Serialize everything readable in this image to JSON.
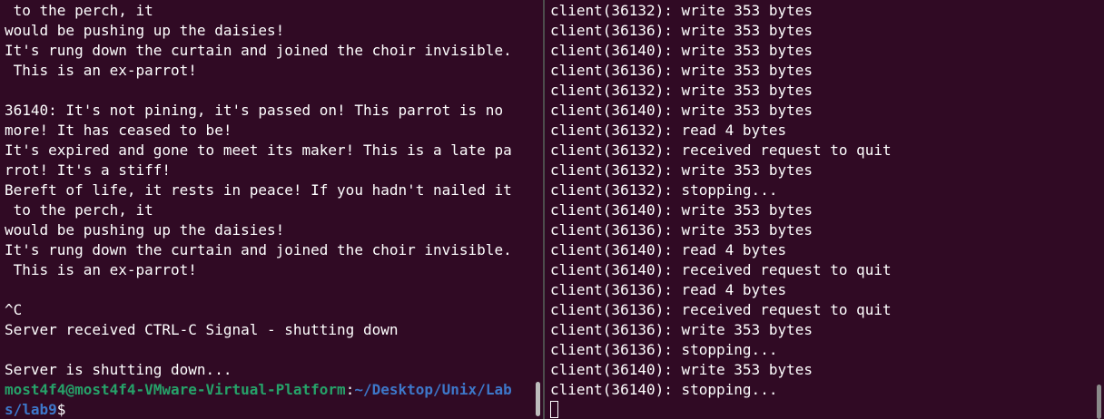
{
  "left_pane": {
    "lines": [
      " to the perch, it",
      "would be pushing up the daisies!",
      "It's rung down the curtain and joined the choir invisible.",
      " This is an ex-parrot!",
      "",
      "36140: It's not pining, it's passed on! This parrot is no",
      "more! It has ceased to be!",
      "It's expired and gone to meet its maker! This is a late pa",
      "rrot! It's a stiff!",
      "Bereft of life, it rests in peace! If you hadn't nailed it",
      " to the perch, it",
      "would be pushing up the daisies!",
      "It's rung down the curtain and joined the choir invisible.",
      " This is an ex-parrot!",
      "",
      "^C",
      "Server received CTRL-C Signal - shutting down",
      "",
      "Server is shutting down..."
    ],
    "prompt": {
      "user_host": "most4f4@most4f4-VMware-Virtual-Platform",
      "separator": ":",
      "path_part1": "~/Desktop/Unix/Lab",
      "path_part2": "s/lab9",
      "symbol": "$"
    }
  },
  "right_pane": {
    "lines": [
      "client(36132): write 353 bytes",
      "client(36136): write 353 bytes",
      "client(36140): write 353 bytes",
      "client(36136): write 353 bytes",
      "client(36132): write 353 bytes",
      "client(36140): write 353 bytes",
      "client(36132): read 4 bytes",
      "client(36132): received request to quit",
      "client(36132): write 353 bytes",
      "client(36132): stopping...",
      "client(36140): write 353 bytes",
      "client(36136): write 353 bytes",
      "client(36140): read 4 bytes",
      "client(36140): received request to quit",
      "client(36136): read 4 bytes",
      "client(36136): received request to quit",
      "client(36136): write 353 bytes",
      "client(36136): stopping...",
      "client(36140): write 353 bytes",
      "client(36140): stopping..."
    ]
  },
  "colors": {
    "background": "#300a24",
    "foreground": "#ffffff",
    "prompt_user": "#26a269",
    "prompt_path": "#3d77c9",
    "divider": "#4d4d4d"
  },
  "icons": {
    "cursor": "block-cursor",
    "inactive_cursor": "outline-cursor"
  }
}
